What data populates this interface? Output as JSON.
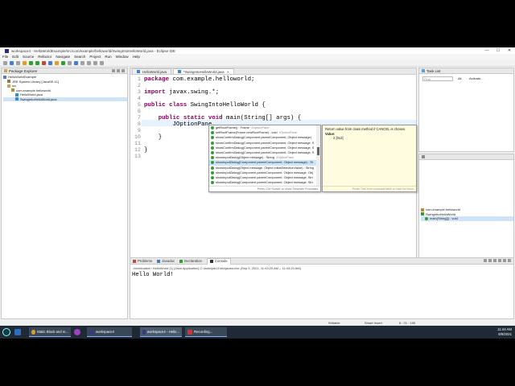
{
  "window": {
    "title": "workspace4 - HelloWorldExample/src/com/example/helloworld/SwingIntoHelloWorld.java - Eclipse IDE",
    "controls": [
      "—",
      "☐",
      "✕"
    ]
  },
  "menu": [
    "File",
    "Edit",
    "Source",
    "Refactor",
    "Navigate",
    "Search",
    "Project",
    "Run",
    "Window",
    "Help"
  ],
  "package_explorer": {
    "title": "Package Explorer",
    "items": [
      {
        "label": "HelloWorldExample",
        "indent": 0
      },
      {
        "label": "JRE System Library [JavaSE-11]",
        "indent": 1
      },
      {
        "label": "src",
        "indent": 1
      },
      {
        "label": "com.example.helloworld",
        "indent": 2
      },
      {
        "label": "HelloWorld.java",
        "indent": 3
      },
      {
        "label": "SwingIntoHelloWorld.java",
        "indent": 3
      }
    ]
  },
  "editor": {
    "tabs": [
      "HelloWorld.java",
      "*SwingIntoHelloWorld.java"
    ],
    "lines": [
      {
        "n": "1",
        "text": "package com.example.helloworld;"
      },
      {
        "n": "2",
        "text": ""
      },
      {
        "n": "3",
        "text": "import javax.swing.*;"
      },
      {
        "n": "4",
        "text": ""
      },
      {
        "n": "5",
        "text": "public class SwingIntoHelloWorld {"
      },
      {
        "n": "6",
        "text": ""
      },
      {
        "n": "7",
        "text": "    public static void main(String[] args) {"
      },
      {
        "n": "8",
        "text": "        JOptionPane."
      },
      {
        "n": "9",
        "text": ""
      },
      {
        "n": "10",
        "text": "    }"
      },
      {
        "n": "11",
        "text": ""
      },
      {
        "n": "12",
        "text": "}"
      },
      {
        "n": "13",
        "text": ""
      }
    ]
  },
  "content_assist": {
    "items": [
      {
        "label": "getRootFrame() : Frame",
        "owner": "JOptionPane"
      },
      {
        "label": "setRootFrame(Frame newRootFrame) : void",
        "owner": "JOptionPane"
      },
      {
        "label": "showConfirmDialog(Component parentComponent, Object message)",
        "owner": ""
      },
      {
        "label": "showConfirmDialog(Component parentComponent, Object message, S",
        "owner": ""
      },
      {
        "label": "showConfirmDialog(Component parentComponent, Object message, S",
        "owner": ""
      },
      {
        "label": "showConfirmDialog(Component parentComponent, Object message, S",
        "owner": ""
      },
      {
        "label": "showInputDialog(Object message) : String",
        "owner": "JOptionPane"
      },
      {
        "label": "showInputDialog(Component parentComponent, Object message) : St",
        "owner": ""
      },
      {
        "label": "showInputDialog(Object message, Object initialSelectionValue) : String",
        "owner": ""
      },
      {
        "label": "showInputDialog(Component parentComponent, Object message, Obj",
        "owner": ""
      },
      {
        "label": "showInputDialog(Component parentComponent, Object message, Stri",
        "owner": ""
      },
      {
        "label": "showInputDialog(Component parentComponent, Object message, Stri",
        "owner": ""
      }
    ],
    "footer": "Press 'Ctrl+Space' to show Template Proposals"
  },
  "javadoc": {
    "text": "Return value from class method if CANCEL is chosen.",
    "value_label": "Value:",
    "value": "2 [0x2]",
    "footer": "Press 'Tab' from proposal table or click for focus"
  },
  "task_list": {
    "title": "Task List",
    "find_placeholder": "Find",
    "all": "All",
    "activate": "Activate..."
  },
  "outline": {
    "items": [
      "com.example.helloworld",
      "SwingIntoHelloWorld",
      "main(String[]) : void"
    ]
  },
  "console": {
    "tabs": [
      "Problems",
      "Javadoc",
      "Declaration",
      "Console"
    ],
    "header": "<terminated> HelloWorld (1) [Java Application] C:\\tools\\jdk11\\bin\\javaw.exe (Sep 9, 2021, 11:43:29 AM – 11:43:29 AM)",
    "output": "Hello World!"
  },
  "status": {
    "writable": "Writable",
    "insert": "Smart Insert",
    "position": "8 : 21 : 155"
  },
  "taskbar": {
    "apps": [
      "Static Block and m...",
      "workspace4",
      "workspace4 - Hello...",
      "Recording..."
    ],
    "time": "11:44 AM",
    "date": "9/9/2021"
  }
}
